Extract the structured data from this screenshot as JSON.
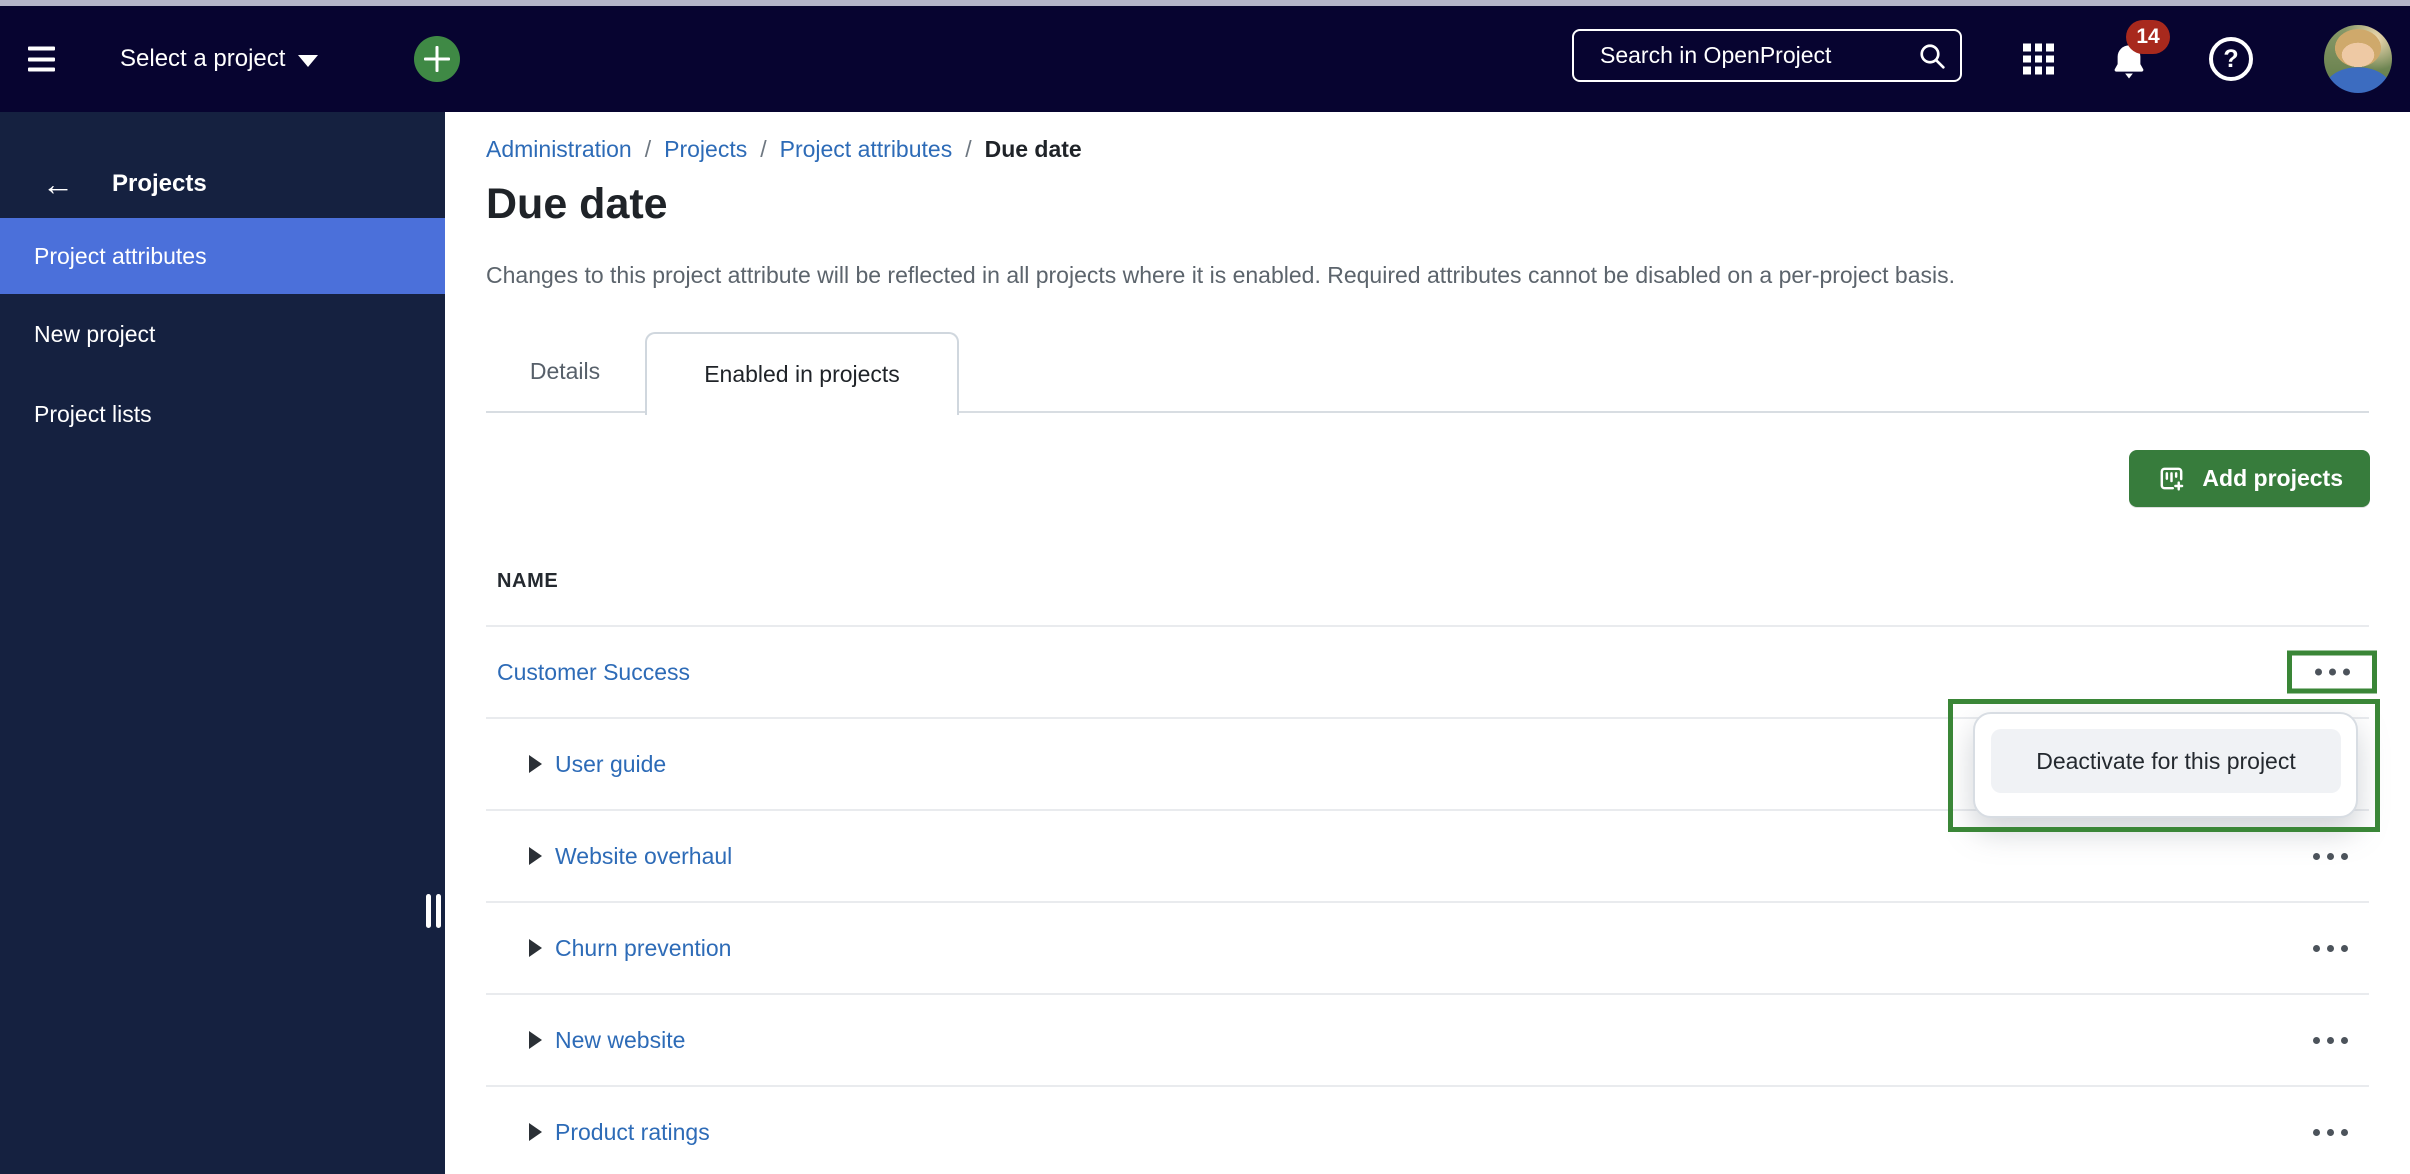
{
  "topbar": {
    "select_project_label": "Select a project",
    "search_placeholder": "Search in OpenProject",
    "notification_count": "14",
    "help_glyph": "?"
  },
  "sidebar": {
    "back_arrow_glyph": "←",
    "title": "Projects",
    "items": [
      {
        "label": "Project attributes",
        "active": true
      },
      {
        "label": "New project",
        "active": false
      },
      {
        "label": "Project lists",
        "active": false
      }
    ]
  },
  "breadcrumb": {
    "links": [
      "Administration",
      "Projects",
      "Project attributes"
    ],
    "separator": "/",
    "current": "Due date"
  },
  "page": {
    "title": "Due date",
    "description": "Changes to this project attribute will be reflected in all projects where it is enabled. Required attributes cannot be disabled on a per-project basis."
  },
  "tabs": [
    {
      "label": "Details",
      "active": false
    },
    {
      "label": "Enabled in projects",
      "active": true
    }
  ],
  "toolbar": {
    "add_projects_label": "Add projects"
  },
  "table": {
    "name_header": "NAME",
    "rows": [
      {
        "label": "Customer Success",
        "indented": false,
        "menu_highlighted": true
      },
      {
        "label": "User guide",
        "indented": true
      },
      {
        "label": "Website overhaul",
        "indented": true
      },
      {
        "label": "Churn prevention",
        "indented": true
      },
      {
        "label": "New website",
        "indented": true
      },
      {
        "label": "Product ratings",
        "indented": true
      }
    ]
  },
  "context_menu": {
    "items": [
      "Deactivate for this project"
    ]
  },
  "colors": {
    "topbar_bg": "#070430",
    "sidebar_bg": "#152140",
    "sidebar_active_bg": "#4b70da",
    "link_blue": "#2d6bb7",
    "button_green": "#377c3c",
    "annotation_green": "#3a8637",
    "badge_red": "#a8291d"
  }
}
